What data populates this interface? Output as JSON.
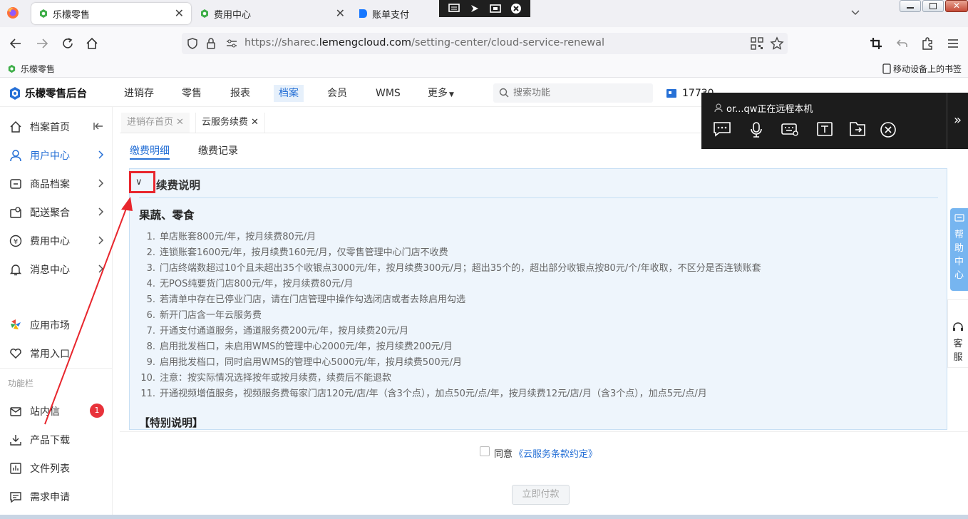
{
  "browser": {
    "tabs": [
      {
        "title": "乐檬零售"
      },
      {
        "title": "费用中心"
      },
      {
        "title": "账单支付"
      }
    ],
    "url": {
      "prefix": "https://sharec.",
      "domain": "lemengcloud.com",
      "path": "/setting-center/cloud-service-renewal"
    },
    "bookmark": "乐檬零售",
    "mobile_bookmarks": "移动设备上的书签"
  },
  "app": {
    "logo_text": "乐檬零售后台",
    "nav": [
      "进销存",
      "零售",
      "报表",
      "档案",
      "会员",
      "WMS",
      "更多"
    ],
    "active_nav": "档案",
    "search_placeholder": "搜索功能",
    "user_partial": "17730"
  },
  "sidebar": {
    "items": [
      {
        "label": "档案首页",
        "icon": "home-icon"
      },
      {
        "label": "用户中心",
        "icon": "user-icon"
      },
      {
        "label": "商品档案",
        "icon": "goods-icon"
      },
      {
        "label": "配送聚合",
        "icon": "delivery-icon"
      },
      {
        "label": "费用中心",
        "icon": "yen-icon"
      },
      {
        "label": "消息中心",
        "icon": "bell-icon"
      }
    ],
    "app_market": "应用市场",
    "favorites": "常用入口",
    "section_title": "功能栏",
    "tools": [
      {
        "label": "站内信",
        "badge": "1"
      },
      {
        "label": "产品下载"
      },
      {
        "label": "文件列表"
      },
      {
        "label": "需求申请"
      }
    ]
  },
  "page_tabs": [
    {
      "label": "进销存首页"
    },
    {
      "label": "云服务续费"
    }
  ],
  "sub_tabs": [
    "缴费明细",
    "缴费记录"
  ],
  "panel": {
    "heading": "续费说明",
    "category": "果蔬、零食",
    "items": [
      "单店账套800元/年，按月续费80元/月",
      "连锁账套1600元/年，按月续费160元/月，仅零售管理中心门店不收费",
      "门店终端数超过10个且未超出35个收银点3000元/年，按月续费300元/月；超出35个的，超出部分收银点按80元/个/年收取，不区分是否连锁账套",
      "无POS纯要货门店800元/年，按月续费80元/月",
      "若清单中存在已停业门店，请在门店管理中操作勾选闭店或者去除启用勾选",
      "新开门店含一年云服务费",
      "开通支付通道服务，通道服务费200元/年，按月续费20元/月",
      "启用批发档口，未启用WMS的管理中心2000元/年，按月续费200元/月",
      "启用批发档口，同时启用WMS的管理中心5000元/年，按月续费500元/月",
      "注意：按实际情况选择按年或按月续费，续费后不能退款",
      "开通视频增值服务，视频服务费每家门店120元/店/年（含3个点），加点50元/点/年，按月续费12元/店/月（含3个点），加点5元/点/月"
    ],
    "special_title": "【特别说明】"
  },
  "footer": {
    "agree_text": "同意",
    "agreement_link": "《云服务条款约定》",
    "pay_button": "立即付款"
  },
  "remote": {
    "status": "or...qw正在远程本机"
  },
  "help": {
    "help_chars": [
      "帮",
      "助",
      "中",
      "心"
    ],
    "service_chars": [
      "客",
      "服"
    ]
  },
  "colors": {
    "accent": "#2670d6",
    "panel_bg": "#eef5fc",
    "annotation_red": "#e8262d"
  }
}
